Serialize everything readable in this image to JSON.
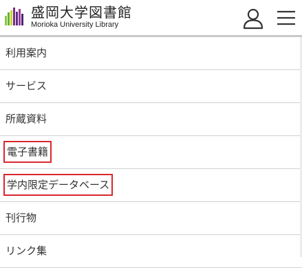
{
  "header": {
    "title": "盛岡大学図書館",
    "subtitle": "Morioka University Library",
    "logo_colors": [
      "#8cc63f",
      "#66b032",
      "#c1d72e",
      "#7a2a8c",
      "#5b2d83",
      "#9b3a9b",
      "#4b2474"
    ]
  },
  "menu": {
    "items": [
      {
        "label": "利用案内",
        "highlighted": false
      },
      {
        "label": "サービス",
        "highlighted": false
      },
      {
        "label": "所蔵資料",
        "highlighted": false
      },
      {
        "label": "電子書籍",
        "highlighted": true
      },
      {
        "label": "学内限定データベース",
        "highlighted": true
      },
      {
        "label": "刊行物",
        "highlighted": false
      },
      {
        "label": "リンク集",
        "highlighted": false
      }
    ]
  },
  "colors": {
    "highlight_border": "#d9262e",
    "divider": "#d0d0d0",
    "text": "#333333"
  },
  "icons": {
    "account": "user-icon",
    "menu": "hamburger-menu-icon",
    "logo": "library-logo-icon"
  }
}
